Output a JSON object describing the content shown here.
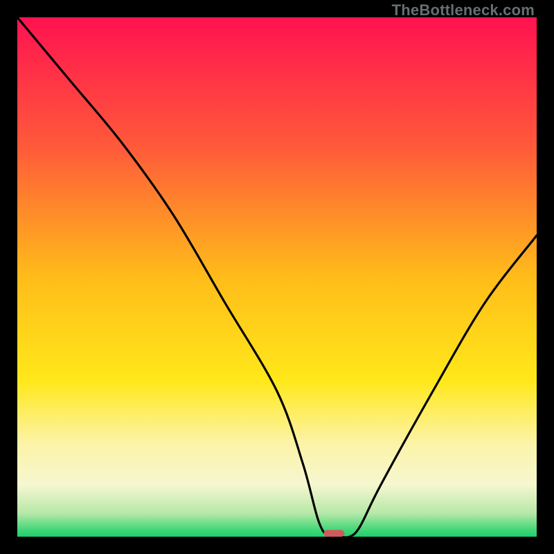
{
  "watermark": "TheBottleneck.com",
  "chart_data": {
    "type": "line",
    "title": "",
    "xlabel": "",
    "ylabel": "",
    "xlim": [
      0,
      100
    ],
    "ylim": [
      0,
      100
    ],
    "grid": false,
    "legend": false,
    "series": [
      {
        "name": "bottleneck-curve",
        "x": [
          0,
          10,
          20,
          30,
          40,
          50,
          55,
          58,
          60,
          62,
          64,
          66,
          70,
          80,
          90,
          100
        ],
        "y": [
          100,
          88,
          76,
          62,
          45,
          28,
          14,
          3,
          0,
          0,
          0,
          2,
          10,
          28,
          45,
          58
        ]
      }
    ],
    "marker": {
      "name": "optimal-marker",
      "x": 61,
      "y": 0,
      "color": "#d15a5f",
      "width": 4,
      "height": 1.3
    },
    "gradient_stops": [
      {
        "offset": 0.0,
        "color": "#ff1250"
      },
      {
        "offset": 0.25,
        "color": "#ff5a3a"
      },
      {
        "offset": 0.5,
        "color": "#ffbc1a"
      },
      {
        "offset": 0.7,
        "color": "#ffe81a"
      },
      {
        "offset": 0.82,
        "color": "#fcf3a8"
      },
      {
        "offset": 0.9,
        "color": "#f6f7d0"
      },
      {
        "offset": 0.955,
        "color": "#b6e8a8"
      },
      {
        "offset": 0.985,
        "color": "#48d87a"
      },
      {
        "offset": 1.0,
        "color": "#1fcf6e"
      }
    ]
  }
}
